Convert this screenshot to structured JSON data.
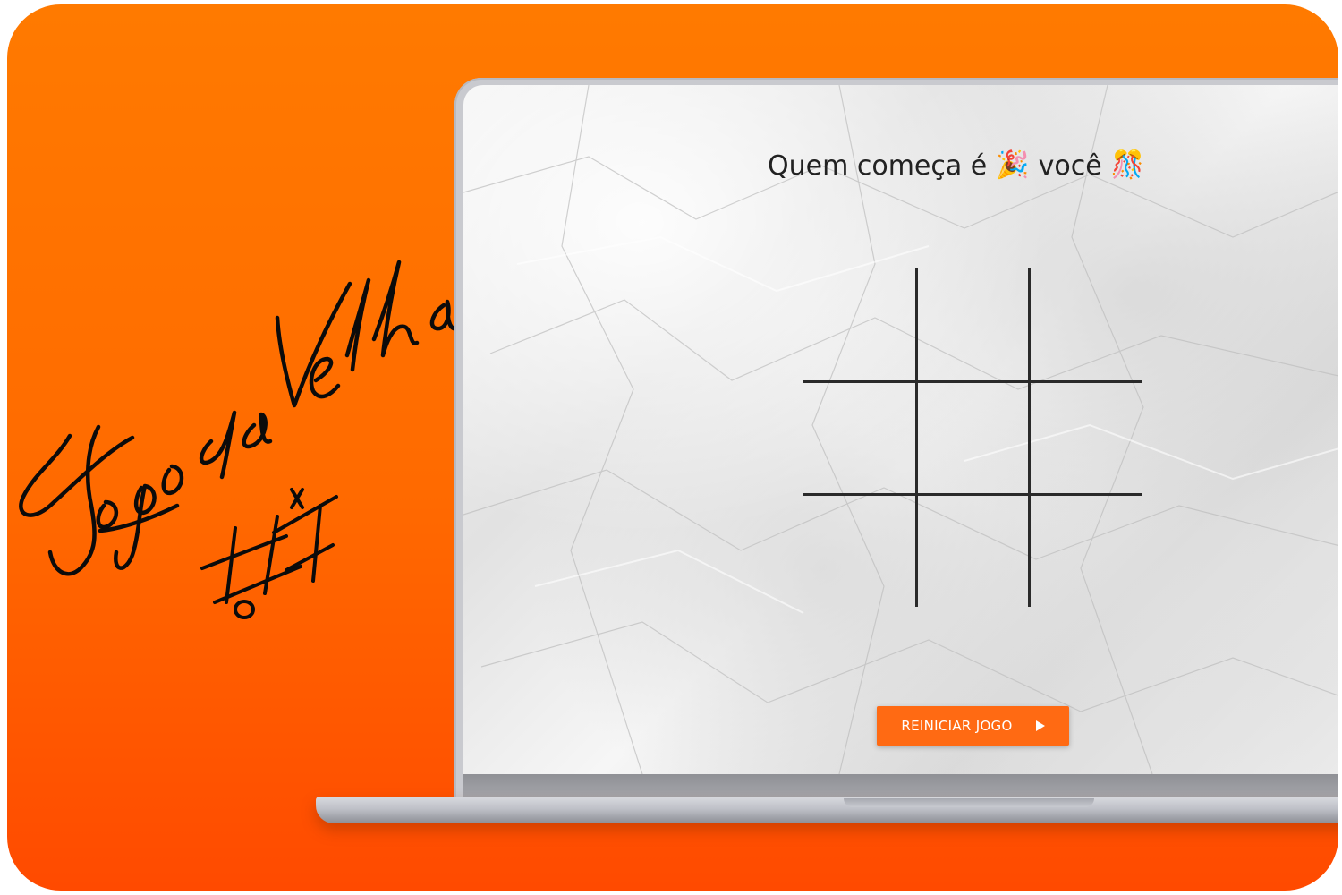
{
  "branding": {
    "title": "Jogo da Velha"
  },
  "game": {
    "turn_message": {
      "prefix": "Quem começa é",
      "player": "você",
      "emoji_left": "🎉",
      "emoji_right": "🎊"
    },
    "board": {
      "cells": [
        "",
        "",
        "",
        "",
        "",
        "",
        "",
        "",
        ""
      ]
    },
    "restart_label": "REINICIAR JOGO",
    "restart_icon": "play-icon"
  },
  "colors": {
    "background_top": "#ff7a00",
    "background_bottom": "#ff4a00",
    "button": "#ff6a13",
    "grid": "#2a2a2a"
  }
}
